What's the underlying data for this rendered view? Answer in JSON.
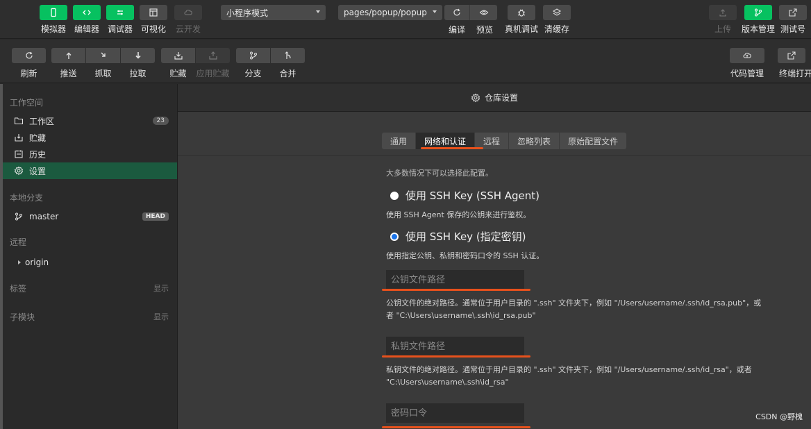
{
  "topbar": {
    "simulator": "模拟器",
    "editor": "编辑器",
    "debugger": "调试器",
    "visual": "可视化",
    "cloud": "云开发",
    "mode_select": "小程序模式",
    "page_select": "pages/popup/popup",
    "compile": "编译",
    "preview": "预览",
    "device_debug": "真机调试",
    "clear_cache": "清缓存",
    "upload": "上传",
    "version_mgmt": "版本管理",
    "test_account": "测试号"
  },
  "gitbar": {
    "refresh": "刷新",
    "push": "推送",
    "fetch": "抓取",
    "pull": "拉取",
    "stash": "贮藏",
    "apply_stash": "应用贮藏",
    "branch": "分支",
    "merge": "合并",
    "code_mgmt": "代码管理",
    "terminal": "终端打开"
  },
  "sidebar": {
    "workspace_title": "工作空间",
    "workspace_items": [
      {
        "label": "工作区",
        "badge": "23"
      },
      {
        "label": "贮藏"
      },
      {
        "label": "历史"
      },
      {
        "label": "设置"
      }
    ],
    "local_branch_title": "本地分支",
    "branch_name": "master",
    "branch_badge": "HEAD",
    "remote_title": "远程",
    "remote_name": "origin",
    "tags_title": "标签",
    "tags_toggle": "显示",
    "submodules_title": "子模块",
    "submodules_toggle": "显示"
  },
  "main": {
    "header": "仓库设置",
    "tabs": [
      "通用",
      "网络和认证",
      "远程",
      "忽略列表",
      "原始配置文件"
    ],
    "active_tab": "网络和认证",
    "top_hint": "大多数情况下可以选择此配置。",
    "option1_label": "使用 SSH Key (SSH Agent)",
    "option1_desc": "使用 SSH Agent 保存的公钥来进行鉴权。",
    "option2_label": "使用 SSH Key (指定密钥)",
    "option2_desc": "使用指定公钥、私钥和密码口令的 SSH 认证。",
    "public_key_placeholder": "公钥文件路径",
    "public_key_desc": "公钥文件的绝对路径。通常位于用户目录的 \".ssh\" 文件夹下，例如 \"/Users/username/.ssh/id_rsa.pub\"，或者 \"C:\\Users\\username\\.ssh\\id_rsa.pub\"",
    "private_key_placeholder": "私钥文件路径",
    "private_key_desc": "私钥文件的绝对路径。通常位于用户目录的 \".ssh\" 文件夹下，例如 \"/Users/username/.ssh/id_rsa\"，或者 \"C:\\Users\\username\\.ssh\\id_rsa\"",
    "passphrase_placeholder": "密码口令"
  },
  "watermark": "CSDN @野槐",
  "colors": {
    "accent_green": "#07c160",
    "annotation_orange": "#e8511c",
    "active_item": "#1b5a3f"
  }
}
